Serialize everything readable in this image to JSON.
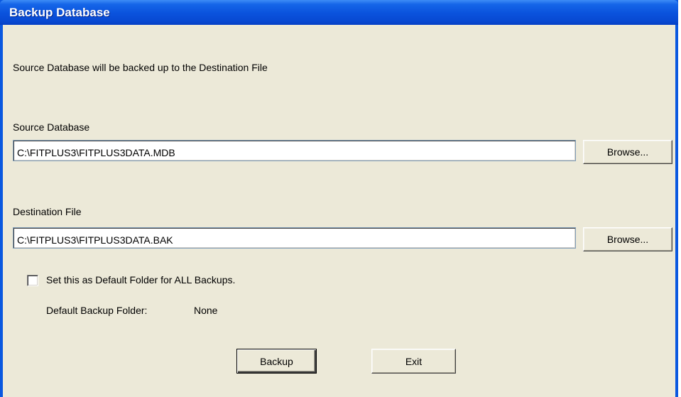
{
  "window": {
    "title": "Backup Database"
  },
  "intro_text": "Source Database will be backed up to the Destination File",
  "source": {
    "label": "Source Database",
    "value": "C:\\FITPLUS3\\FITPLUS3DATA.MDB",
    "browse_label": "Browse..."
  },
  "destination": {
    "label": "Destination File",
    "value": "C:\\FITPLUS3\\FITPLUS3DATA.BAK",
    "browse_label": "Browse..."
  },
  "default_folder_checkbox": {
    "label": "Set this as Default Folder for ALL Backups.",
    "checked": false
  },
  "default_backup_folder": {
    "label": "Default Backup Folder:",
    "value": "None"
  },
  "actions": {
    "backup_label": "Backup",
    "exit_label": "Exit"
  }
}
